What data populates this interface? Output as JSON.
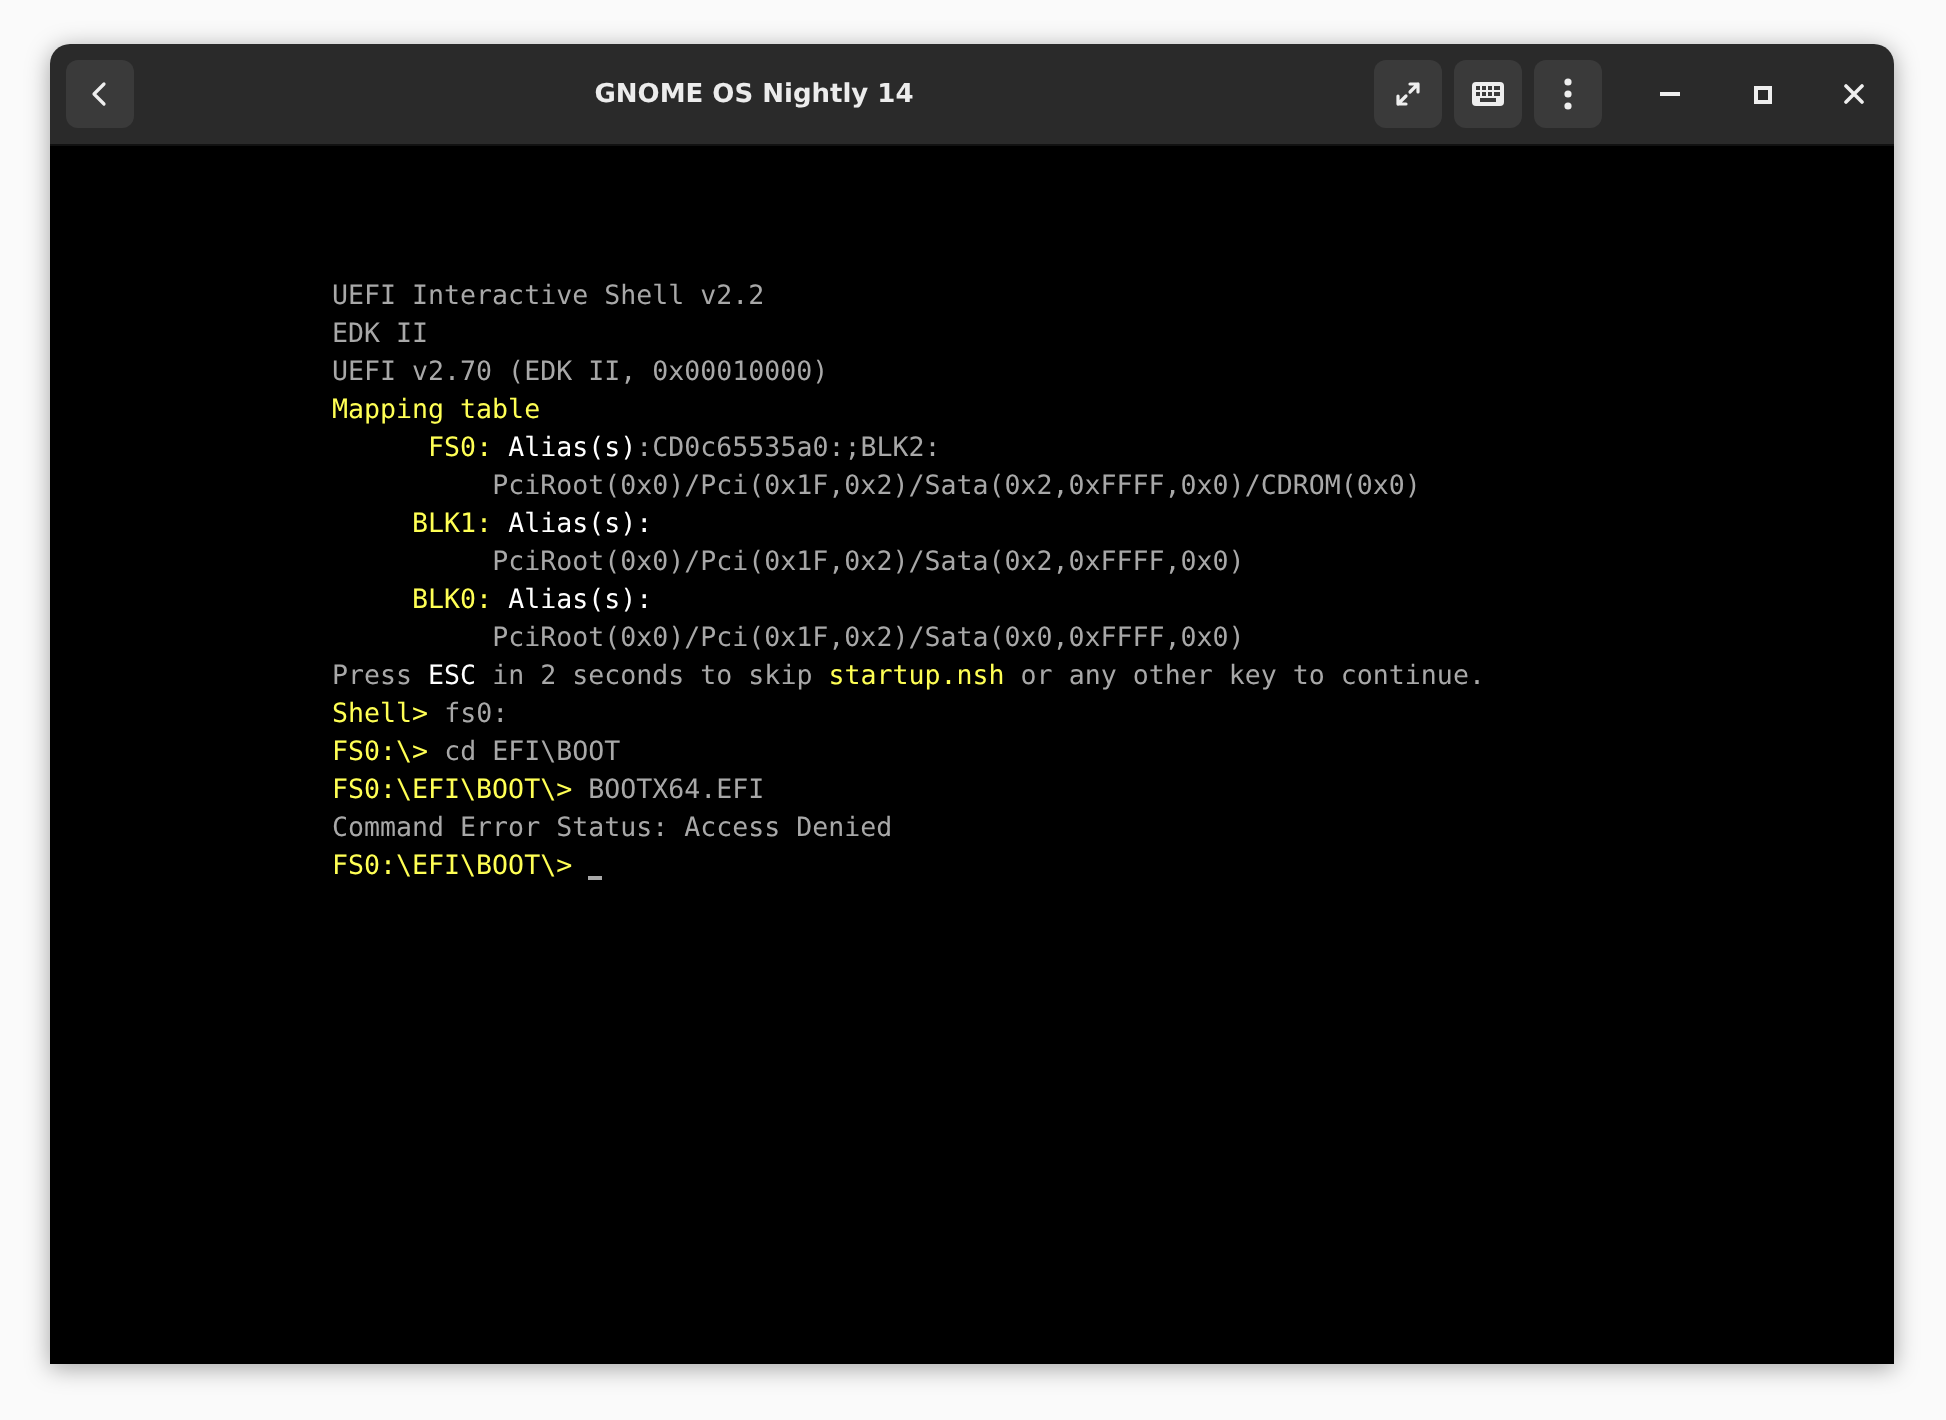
{
  "window": {
    "title": "GNOME OS Nightly 14"
  },
  "terminal": {
    "lines": [
      {
        "segments": [
          {
            "kind": "plain",
            "text": "UEFI Interactive Shell v2.2"
          }
        ]
      },
      {
        "segments": [
          {
            "kind": "plain",
            "text": "EDK II"
          }
        ]
      },
      {
        "segments": [
          {
            "kind": "plain",
            "text": "UEFI v2.70 (EDK II, 0x00010000)"
          }
        ]
      },
      {
        "segments": [
          {
            "kind": "yellow",
            "text": "Mapping table"
          }
        ]
      },
      {
        "segments": [
          {
            "kind": "yellow",
            "text": "      FS0:"
          },
          {
            "kind": "white",
            "text": " Alias(s)"
          },
          {
            "kind": "plain",
            "text": ":CD0c65535a0:;BLK2:"
          }
        ]
      },
      {
        "segments": [
          {
            "kind": "plain",
            "text": "          PciRoot(0x0)/Pci(0x1F,0x2)/Sata(0x2,0xFFFF,0x0)/CDROM(0x0)"
          }
        ]
      },
      {
        "segments": [
          {
            "kind": "yellow",
            "text": "     BLK1:"
          },
          {
            "kind": "white",
            "text": " Alias(s):"
          }
        ]
      },
      {
        "segments": [
          {
            "kind": "plain",
            "text": "          PciRoot(0x0)/Pci(0x1F,0x2)/Sata(0x2,0xFFFF,0x0)"
          }
        ]
      },
      {
        "segments": [
          {
            "kind": "yellow",
            "text": "     BLK0:"
          },
          {
            "kind": "white",
            "text": " Alias(s):"
          }
        ]
      },
      {
        "segments": [
          {
            "kind": "plain",
            "text": "          PciRoot(0x0)/Pci(0x1F,0x2)/Sata(0x0,0xFFFF,0x0)"
          }
        ]
      },
      {
        "segments": [
          {
            "kind": "plain",
            "text": "Press "
          },
          {
            "kind": "white",
            "text": "ESC"
          },
          {
            "kind": "plain",
            "text": " in 2 seconds to skip "
          },
          {
            "kind": "yellow",
            "text": "startup.nsh"
          },
          {
            "kind": "plain",
            "text": " or any other key to continue."
          }
        ]
      },
      {
        "segments": [
          {
            "kind": "yellow",
            "text": "Shell>"
          },
          {
            "kind": "plain",
            "text": " fs0:"
          }
        ]
      },
      {
        "segments": [
          {
            "kind": "yellow",
            "text": "FS0:\\>"
          },
          {
            "kind": "plain",
            "text": " cd EFI\\BOOT"
          }
        ]
      },
      {
        "segments": [
          {
            "kind": "yellow",
            "text": "FS0:\\EFI\\BOOT\\>"
          },
          {
            "kind": "plain",
            "text": " BOOTX64.EFI"
          }
        ]
      },
      {
        "segments": [
          {
            "kind": "plain",
            "text": "Command Error Status: Access Denied"
          }
        ]
      },
      {
        "segments": [
          {
            "kind": "yellow",
            "text": "FS0:\\EFI\\BOOT\\>"
          }
        ],
        "cursor": true
      }
    ]
  }
}
